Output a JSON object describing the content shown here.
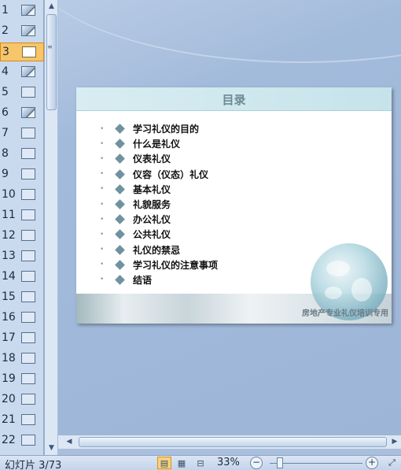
{
  "thumbnails": [
    {
      "num": "1",
      "style": "img"
    },
    {
      "num": "2",
      "style": "img"
    },
    {
      "num": "3",
      "style": "plain",
      "selected": true
    },
    {
      "num": "4",
      "style": "img"
    },
    {
      "num": "5",
      "style": "plain"
    },
    {
      "num": "6",
      "style": "img"
    },
    {
      "num": "7",
      "style": "plain"
    },
    {
      "num": "8",
      "style": "plain"
    },
    {
      "num": "9",
      "style": "plain"
    },
    {
      "num": "10",
      "style": "plain"
    },
    {
      "num": "11",
      "style": "plain"
    },
    {
      "num": "12",
      "style": "plain"
    },
    {
      "num": "13",
      "style": "plain"
    },
    {
      "num": "14",
      "style": "plain"
    },
    {
      "num": "15",
      "style": "plain"
    },
    {
      "num": "16",
      "style": "plain"
    },
    {
      "num": "17",
      "style": "plain"
    },
    {
      "num": "18",
      "style": "plain"
    },
    {
      "num": "19",
      "style": "plain"
    },
    {
      "num": "20",
      "style": "plain"
    },
    {
      "num": "21",
      "style": "plain"
    },
    {
      "num": "22",
      "style": "plain"
    }
  ],
  "slide": {
    "title": "目录",
    "items": [
      "学习礼仪的目的",
      "什么是礼仪",
      "仪表礼仪",
      "仪容（仪态）礼仪",
      "基本礼仪",
      "礼貌服务",
      "办公礼仪",
      "公共礼仪",
      "礼仪的禁忌",
      "学习礼仪的注意事项",
      "结语"
    ],
    "footer": "房地产专业礼仪培训专用"
  },
  "status": {
    "slide_counter": "幻灯片 3/73",
    "zoom": "33%"
  },
  "colors": {
    "selected_thumb": "#f7c56a",
    "title_text": "#6d8a96",
    "bullet_diamond": "#6f92a0"
  }
}
